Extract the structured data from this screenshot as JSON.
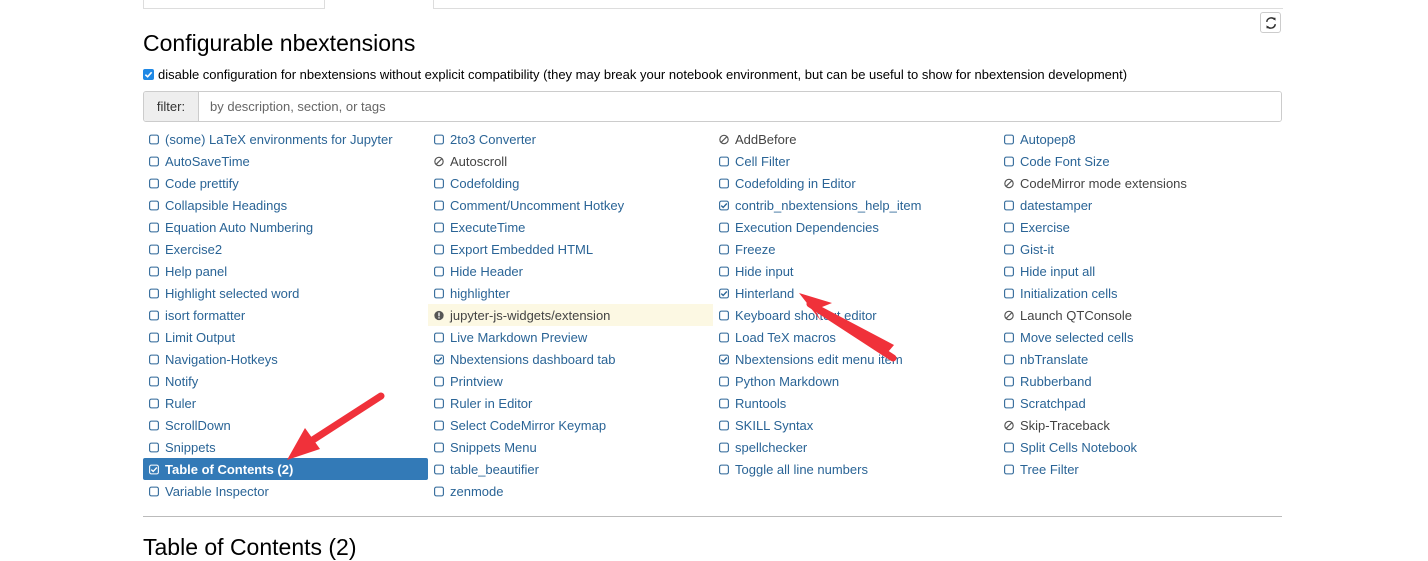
{
  "heading": "Configurable nbextensions",
  "compat_checkbox": {
    "checked": true,
    "label": "disable configuration for nbextensions without explicit compatibility (they may break your notebook environment, but can be useful to show for nbextension development)"
  },
  "filter": {
    "label": "filter:",
    "placeholder": "by description, section, or tags"
  },
  "columns": [
    [
      {
        "label": "(some) LaTeX environments for Jupyter",
        "state": "unchecked"
      },
      {
        "label": "AutoSaveTime",
        "state": "unchecked"
      },
      {
        "label": "Code prettify",
        "state": "unchecked"
      },
      {
        "label": "Collapsible Headings",
        "state": "unchecked"
      },
      {
        "label": "Equation Auto Numbering",
        "state": "unchecked"
      },
      {
        "label": "Exercise2",
        "state": "unchecked"
      },
      {
        "label": "Help panel",
        "state": "unchecked"
      },
      {
        "label": "Highlight selected word",
        "state": "unchecked"
      },
      {
        "label": "isort formatter",
        "state": "unchecked"
      },
      {
        "label": "Limit Output",
        "state": "unchecked"
      },
      {
        "label": "Navigation-Hotkeys",
        "state": "unchecked"
      },
      {
        "label": "Notify",
        "state": "unchecked"
      },
      {
        "label": "Ruler",
        "state": "unchecked"
      },
      {
        "label": "ScrollDown",
        "state": "unchecked"
      },
      {
        "label": "Snippets",
        "state": "unchecked"
      },
      {
        "label": "Table of Contents (2)",
        "state": "checked",
        "selected": true
      },
      {
        "label": "Variable Inspector",
        "state": "unchecked"
      }
    ],
    [
      {
        "label": "2to3 Converter",
        "state": "unchecked"
      },
      {
        "label": "Autoscroll",
        "state": "disabled"
      },
      {
        "label": "Codefolding",
        "state": "unchecked"
      },
      {
        "label": "Comment/Uncomment Hotkey",
        "state": "unchecked"
      },
      {
        "label": "ExecuteTime",
        "state": "unchecked"
      },
      {
        "label": "Export Embedded HTML",
        "state": "unchecked"
      },
      {
        "label": "Hide Header",
        "state": "unchecked"
      },
      {
        "label": "highlighter",
        "state": "unchecked"
      },
      {
        "label": "jupyter-js-widgets/extension",
        "state": "warning"
      },
      {
        "label": "Live Markdown Preview",
        "state": "unchecked"
      },
      {
        "label": "Nbextensions dashboard tab",
        "state": "checked"
      },
      {
        "label": "Printview",
        "state": "unchecked"
      },
      {
        "label": "Ruler in Editor",
        "state": "unchecked"
      },
      {
        "label": "Select CodeMirror Keymap",
        "state": "unchecked"
      },
      {
        "label": "Snippets Menu",
        "state": "unchecked"
      },
      {
        "label": "table_beautifier",
        "state": "unchecked"
      },
      {
        "label": "zenmode",
        "state": "unchecked"
      }
    ],
    [
      {
        "label": "AddBefore",
        "state": "disabled"
      },
      {
        "label": "Cell Filter",
        "state": "unchecked"
      },
      {
        "label": "Codefolding in Editor",
        "state": "unchecked"
      },
      {
        "label": "contrib_nbextensions_help_item",
        "state": "checked"
      },
      {
        "label": "Execution Dependencies",
        "state": "unchecked"
      },
      {
        "label": "Freeze",
        "state": "unchecked"
      },
      {
        "label": "Hide input",
        "state": "unchecked"
      },
      {
        "label": "Hinterland",
        "state": "checked"
      },
      {
        "label": "Keyboard shortcut editor",
        "state": "unchecked"
      },
      {
        "label": "Load TeX macros",
        "state": "unchecked"
      },
      {
        "label": "Nbextensions edit menu item",
        "state": "checked"
      },
      {
        "label": "Python Markdown",
        "state": "unchecked"
      },
      {
        "label": "Runtools",
        "state": "unchecked"
      },
      {
        "label": "SKILL Syntax",
        "state": "unchecked"
      },
      {
        "label": "spellchecker",
        "state": "unchecked"
      },
      {
        "label": "Toggle all line numbers",
        "state": "unchecked"
      }
    ],
    [
      {
        "label": "Autopep8",
        "state": "unchecked"
      },
      {
        "label": "Code Font Size",
        "state": "unchecked"
      },
      {
        "label": "CodeMirror mode extensions",
        "state": "disabled"
      },
      {
        "label": "datestamper",
        "state": "unchecked"
      },
      {
        "label": "Exercise",
        "state": "unchecked"
      },
      {
        "label": "Gist-it",
        "state": "unchecked"
      },
      {
        "label": "Hide input all",
        "state": "unchecked"
      },
      {
        "label": "Initialization cells",
        "state": "unchecked"
      },
      {
        "label": "Launch QTConsole",
        "state": "disabled"
      },
      {
        "label": "Move selected cells",
        "state": "unchecked"
      },
      {
        "label": "nbTranslate",
        "state": "unchecked"
      },
      {
        "label": "Rubberband",
        "state": "unchecked"
      },
      {
        "label": "Scratchpad",
        "state": "unchecked"
      },
      {
        "label": "Skip-Traceback",
        "state": "disabled"
      },
      {
        "label": "Split Cells Notebook",
        "state": "unchecked"
      },
      {
        "label": "Tree Filter",
        "state": "unchecked"
      }
    ]
  ],
  "section_heading": "Table of Contents (2)",
  "colors": {
    "link": "#2a6496",
    "selected_bg": "#337ab7",
    "warning_bg": "#fcf8e3",
    "annotation_arrow": "#f0313a"
  }
}
